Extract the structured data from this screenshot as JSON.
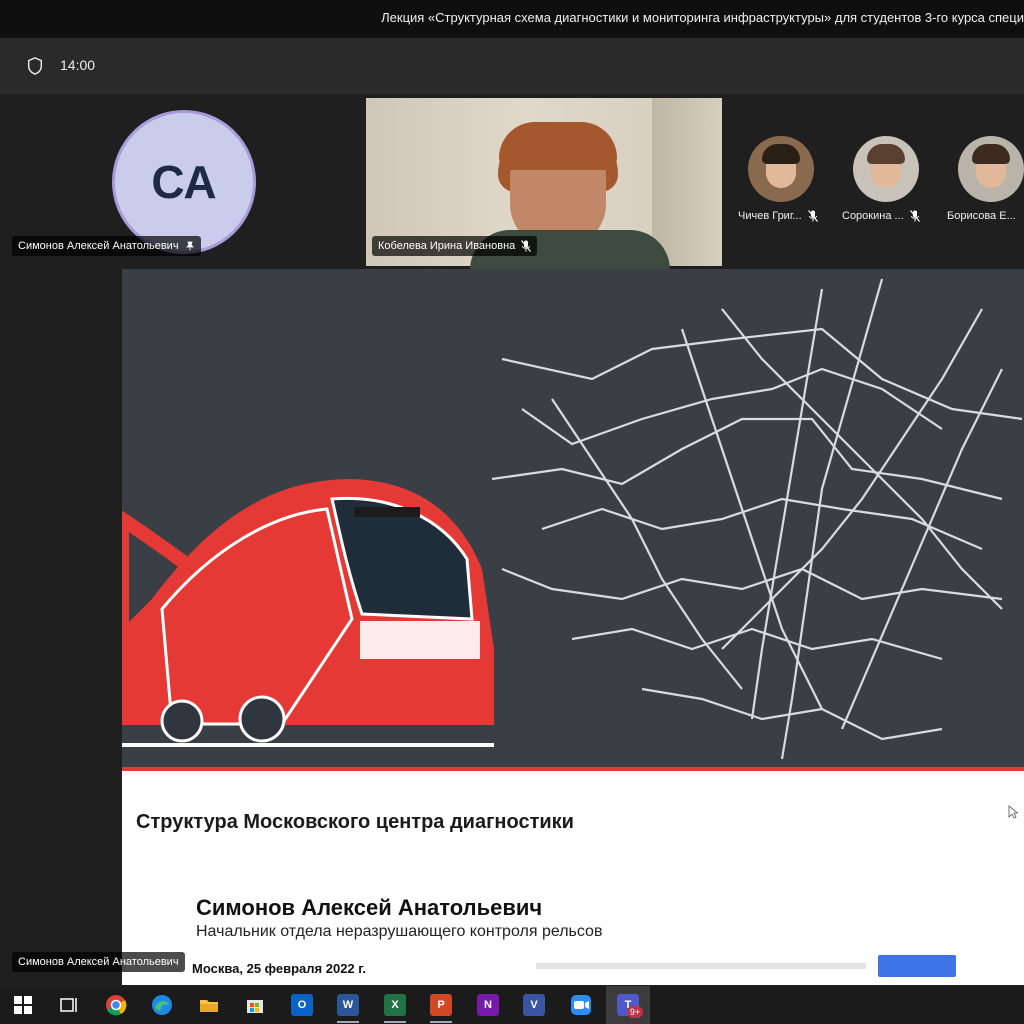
{
  "window": {
    "title": "Лекция «Структурная схема диагностики и мониторинга инфраструктуры» для студентов 3-го курса специ"
  },
  "meeting": {
    "duration": "14:00",
    "icons": {
      "shield": "shield-icon"
    }
  },
  "participants": {
    "presenter": {
      "initials": "СА",
      "name": "Симонов Алексей Анатольевич",
      "pinned": true
    },
    "active_video": {
      "name": "Кобелева Ирина Ивановна",
      "muted": true
    },
    "thumbnails": [
      {
        "name": "Чичев Григ...",
        "muted": true
      },
      {
        "name": "Сорокина ...",
        "muted": true
      },
      {
        "name": "Борисова Е...",
        "muted": false
      }
    ],
    "screen_share_label": "Симонов Алексей Анатольевич"
  },
  "slide": {
    "heading": "Структура Московского центра диагностики",
    "speaker_name": "Симонов Алексей Анатольевич",
    "speaker_role": "Начальник отдела неразрушающего контроля рельсов",
    "date_line": "Москва, 25 февраля 2022 г.",
    "accent_color": "#e53935"
  },
  "taskbar": {
    "icons": [
      {
        "name": "windows-start-icon"
      },
      {
        "name": "task-view-icon"
      },
      {
        "name": "chrome-icon"
      },
      {
        "name": "edge-icon"
      },
      {
        "name": "file-explorer-icon"
      },
      {
        "name": "store-icon"
      },
      {
        "name": "outlook-icon",
        "glyph": "O"
      },
      {
        "name": "word-icon",
        "glyph": "W"
      },
      {
        "name": "excel-icon",
        "glyph": "X"
      },
      {
        "name": "powerpoint-icon",
        "glyph": "P"
      },
      {
        "name": "onenote-icon",
        "glyph": "N"
      },
      {
        "name": "visio-icon",
        "glyph": "V"
      },
      {
        "name": "zoom-icon"
      },
      {
        "name": "teams-icon",
        "glyph": "T",
        "badge": "9+"
      }
    ]
  }
}
